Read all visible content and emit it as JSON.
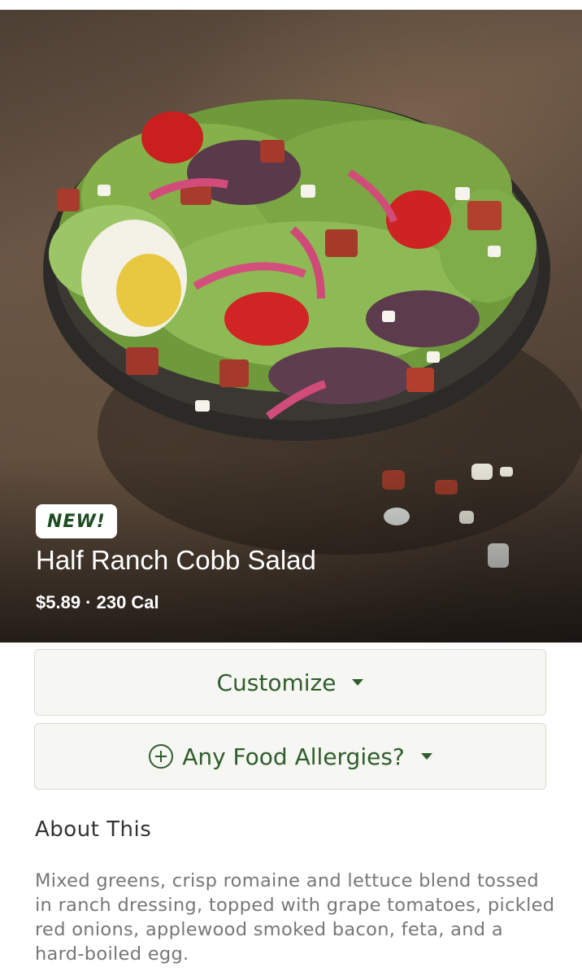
{
  "hero": {
    "image_alt": "Half Ranch Cobb Salad in a dark bowl on a brown stone surface",
    "badge": "NEW!",
    "title": "Half Ranch Cobb Salad",
    "meta": "$5.89 · 230 Cal"
  },
  "actions": {
    "customize_label": "Customize",
    "allergy_label": "Any Food Allergies?"
  },
  "about": {
    "heading": "About This",
    "description": "Mixed greens, crisp romaine and lettuce blend tossed in ranch dressing, topped with grape tomatoes, pickled red onions, applewood smoked bacon, feta, and a hard-boiled egg."
  },
  "colors": {
    "brand_green": "#2f5e2c",
    "badge_green": "#1f4d22"
  },
  "icons": {
    "allergy": "plus-circle-icon",
    "dropdown": "caret-down-icon"
  }
}
